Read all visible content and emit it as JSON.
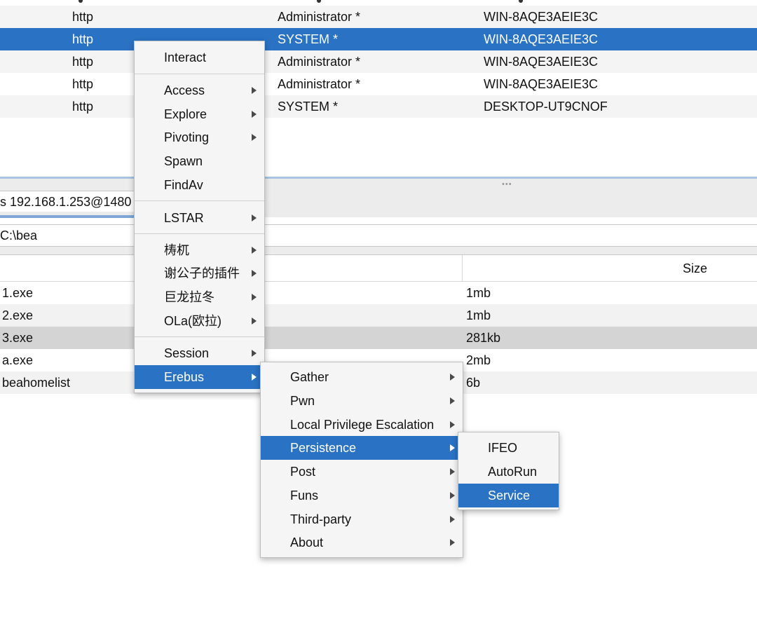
{
  "sessions": {
    "rows": [
      {
        "listener": "http",
        "user": "Administrator *",
        "computer": "WIN-8AQE3AEIE3C"
      },
      {
        "listener": "http",
        "user": "SYSTEM *",
        "computer": "WIN-8AQE3AEIE3C"
      },
      {
        "listener": "http",
        "user": "Administrator *",
        "computer": "WIN-8AQE3AEIE3C"
      },
      {
        "listener": "http",
        "user": "Administrator *",
        "computer": "WIN-8AQE3AEIE3C"
      },
      {
        "listener": "http",
        "user": "SYSTEM *",
        "computer": "DESKTOP-UT9CNOF"
      }
    ]
  },
  "splitter": {
    "dots": "•••"
  },
  "tab": {
    "label": "s 192.168.1.253@1480"
  },
  "path_bar": {
    "value": "C:\\bea"
  },
  "file_table": {
    "size_header": "Size",
    "rows": [
      {
        "name": "1.exe",
        "size": "1mb"
      },
      {
        "name": "2.exe",
        "size": "1mb"
      },
      {
        "name": "3.exe",
        "size": "281kb"
      },
      {
        "name": "a.exe",
        "size": "2mb"
      },
      {
        "name": "beahomelist",
        "size": "6b"
      }
    ]
  },
  "context_menu": {
    "items": [
      {
        "label": "Interact"
      },
      {
        "label": "Access"
      },
      {
        "label": "Explore"
      },
      {
        "label": "Pivoting"
      },
      {
        "label": "Spawn"
      },
      {
        "label": "FindAv"
      },
      {
        "label": "LSTAR"
      },
      {
        "label": "梼杌"
      },
      {
        "label": "谢公子的插件"
      },
      {
        "label": "巨龙拉冬"
      },
      {
        "label": "OLa(欧拉)"
      },
      {
        "label": "Session"
      },
      {
        "label": "Erebus"
      }
    ]
  },
  "erebus_menu": {
    "items": [
      {
        "label": "Gather"
      },
      {
        "label": "Pwn"
      },
      {
        "label": "Local Privilege Escalation"
      },
      {
        "label": "Persistence"
      },
      {
        "label": "Post"
      },
      {
        "label": "Funs"
      },
      {
        "label": "Third-party"
      },
      {
        "label": "About"
      }
    ]
  },
  "persistence_menu": {
    "items": [
      {
        "label": "IFEO"
      },
      {
        "label": "AutoRun"
      },
      {
        "label": "Service"
      }
    ]
  },
  "colors": {
    "selection": "#2a72c3",
    "row_alt": "#f4f4f4",
    "file_selected": "#d4d4d4",
    "menu_bg": "#f5f5f5"
  }
}
